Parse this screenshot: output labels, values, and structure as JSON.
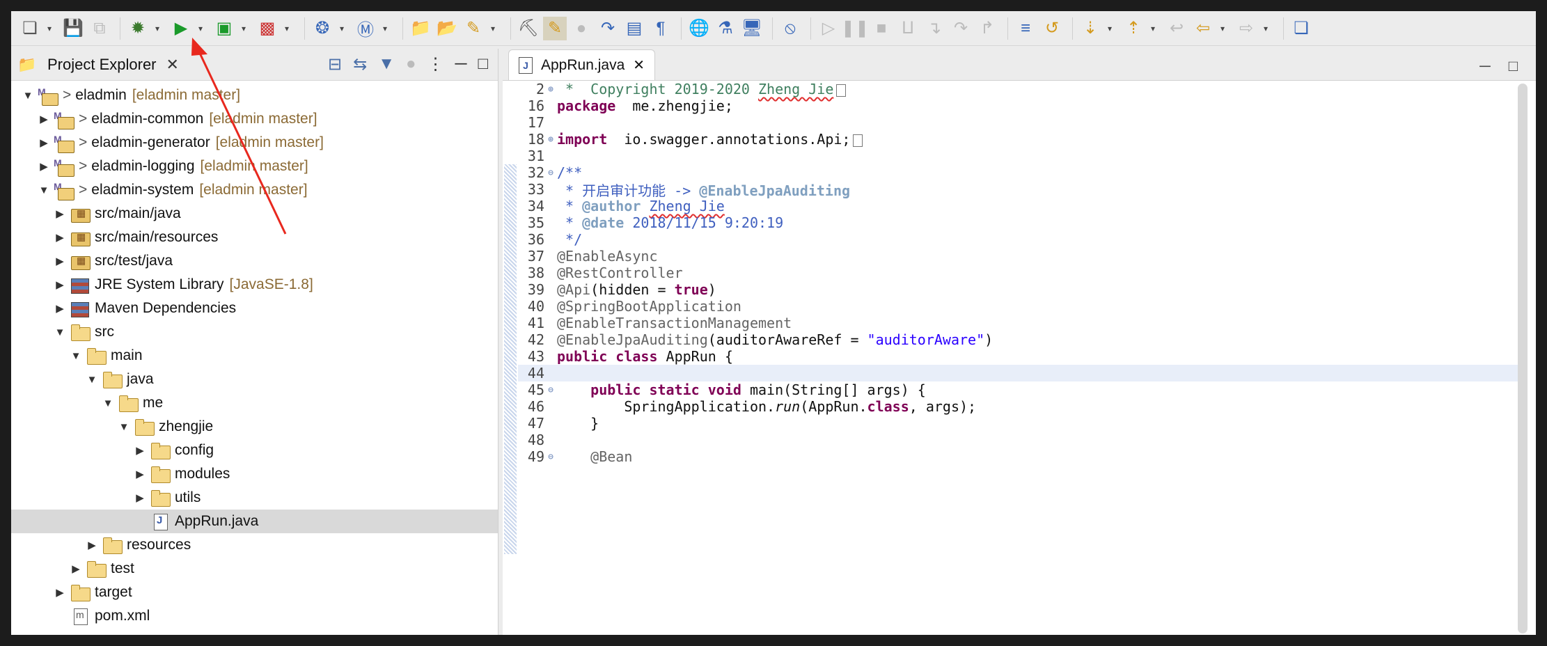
{
  "toolbar": {
    "icons": [
      "new-icon",
      "save-icon",
      "save-all-icon",
      "debug-icon",
      "run-icon",
      "coverage-icon",
      "run-last-icon",
      "external-tools-icon",
      "new-java-class-icon",
      "open-type-icon",
      "open-resource-icon",
      "search-icon",
      "toggle-mark-icon",
      "toggle-block-icon",
      "show-whitespace-icon",
      "globe-icon",
      "server-icon",
      "monitor-icon",
      "skip-breakpoints-icon",
      "resume-icon",
      "suspend-icon",
      "terminate-icon",
      "disconnect-icon",
      "step-into-icon",
      "step-over-icon",
      "step-return-icon",
      "next-annotation-icon",
      "prev-annotation-icon",
      "back-icon",
      "forward-icon",
      "open-perspective-icon"
    ]
  },
  "explorer": {
    "title": "Project Explorer",
    "tree": [
      {
        "label": "eladmin",
        "decoration": "[eladmin master]",
        "prefix": ">",
        "depth": 0,
        "expanded": "open",
        "icon": "proj"
      },
      {
        "label": "eladmin-common",
        "decoration": "[eladmin master]",
        "prefix": ">",
        "depth": 1,
        "expanded": "closed",
        "icon": "proj"
      },
      {
        "label": "eladmin-generator",
        "decoration": "[eladmin master]",
        "prefix": ">",
        "depth": 1,
        "expanded": "closed",
        "icon": "proj"
      },
      {
        "label": "eladmin-logging",
        "decoration": "[eladmin master]",
        "prefix": ">",
        "depth": 1,
        "expanded": "closed",
        "icon": "proj"
      },
      {
        "label": "eladmin-system",
        "decoration": "[eladmin master]",
        "prefix": ">",
        "depth": 1,
        "expanded": "open",
        "icon": "proj"
      },
      {
        "label": "src/main/java",
        "decoration": "",
        "prefix": "",
        "depth": 2,
        "expanded": "closed",
        "icon": "pkg"
      },
      {
        "label": "src/main/resources",
        "decoration": "",
        "prefix": "",
        "depth": 2,
        "expanded": "closed",
        "icon": "pkg"
      },
      {
        "label": "src/test/java",
        "decoration": "",
        "prefix": "",
        "depth": 2,
        "expanded": "closed",
        "icon": "pkg"
      },
      {
        "label": "JRE System Library",
        "decoration": "[JavaSE-1.8]",
        "prefix": "",
        "depth": 2,
        "expanded": "closed",
        "icon": "lib"
      },
      {
        "label": "Maven Dependencies",
        "decoration": "",
        "prefix": "",
        "depth": 2,
        "expanded": "closed",
        "icon": "lib"
      },
      {
        "label": "src",
        "decoration": "",
        "prefix": "",
        "depth": 2,
        "expanded": "open",
        "icon": "folder"
      },
      {
        "label": "main",
        "decoration": "",
        "prefix": "",
        "depth": 3,
        "expanded": "open",
        "icon": "folder"
      },
      {
        "label": "java",
        "decoration": "",
        "prefix": "",
        "depth": 4,
        "expanded": "open",
        "icon": "folder"
      },
      {
        "label": "me",
        "decoration": "",
        "prefix": "",
        "depth": 5,
        "expanded": "open",
        "icon": "folder"
      },
      {
        "label": "zhengjie",
        "decoration": "",
        "prefix": "",
        "depth": 6,
        "expanded": "open",
        "icon": "folder"
      },
      {
        "label": "config",
        "decoration": "",
        "prefix": "",
        "depth": 7,
        "expanded": "closed",
        "icon": "folder"
      },
      {
        "label": "modules",
        "decoration": "",
        "prefix": "",
        "depth": 7,
        "expanded": "closed",
        "icon": "folder"
      },
      {
        "label": "utils",
        "decoration": "",
        "prefix": "",
        "depth": 7,
        "expanded": "closed",
        "icon": "folder"
      },
      {
        "label": "AppRun.java",
        "decoration": "",
        "prefix": "",
        "depth": 7,
        "expanded": "none",
        "icon": "file",
        "selected": true
      },
      {
        "label": "resources",
        "decoration": "",
        "prefix": "",
        "depth": 4,
        "expanded": "closed",
        "icon": "folder"
      },
      {
        "label": "test",
        "decoration": "",
        "prefix": "",
        "depth": 3,
        "expanded": "closed",
        "icon": "folder"
      },
      {
        "label": "target",
        "decoration": "",
        "prefix": "",
        "depth": 2,
        "expanded": "closed",
        "icon": "folder"
      },
      {
        "label": "pom.xml",
        "decoration": "",
        "prefix": "",
        "depth": 2,
        "expanded": "none",
        "icon": "xml"
      }
    ]
  },
  "editor": {
    "tab_label": "AppRun.java",
    "lines": [
      {
        "num": "2",
        "fold": "plus",
        "segs": [
          [
            "cm",
            " *  Copyright 2019-2020 "
          ],
          [
            "cm sq",
            "Zheng Jie"
          ]
        ],
        "elide": true
      },
      {
        "num": "16",
        "segs": [
          [
            "kw",
            "package"
          ],
          [
            "",
            "  me.zhengjie;"
          ]
        ]
      },
      {
        "num": "17",
        "segs": []
      },
      {
        "num": "18",
        "fold": "plus",
        "segs": [
          [
            "kw",
            "import"
          ],
          [
            "",
            "  io.swagger.annotations.Api;"
          ]
        ],
        "elide": true
      },
      {
        "num": "31",
        "segs": []
      },
      {
        "num": "32",
        "fold": "minus",
        "segs": [
          [
            "jd",
            "/**"
          ]
        ]
      },
      {
        "num": "33",
        "segs": [
          [
            "jd",
            " * 开启审计功能 -> "
          ],
          [
            "tag",
            "@EnableJpaAuditing"
          ]
        ]
      },
      {
        "num": "34",
        "segs": [
          [
            "jd",
            " * "
          ],
          [
            "tag",
            "@author"
          ],
          [
            "jd",
            " "
          ],
          [
            "jd sq",
            "Zheng Jie"
          ]
        ]
      },
      {
        "num": "35",
        "segs": [
          [
            "jd",
            " * "
          ],
          [
            "tag",
            "@date"
          ],
          [
            "jd",
            " 2018/11/15 9:20:19"
          ]
        ]
      },
      {
        "num": "36",
        "segs": [
          [
            "jd",
            " */"
          ]
        ]
      },
      {
        "num": "37",
        "segs": [
          [
            "ann",
            "@EnableAsync"
          ]
        ]
      },
      {
        "num": "38",
        "segs": [
          [
            "ann",
            "@RestController"
          ]
        ]
      },
      {
        "num": "39",
        "segs": [
          [
            "ann",
            "@Api"
          ],
          [
            "",
            "(hidden = "
          ],
          [
            "kw",
            "true"
          ],
          [
            "",
            ")"
          ]
        ]
      },
      {
        "num": "40",
        "segs": [
          [
            "ann",
            "@SpringBootApplication"
          ]
        ]
      },
      {
        "num": "41",
        "segs": [
          [
            "ann",
            "@EnableTransactionManagement"
          ]
        ]
      },
      {
        "num": "42",
        "segs": [
          [
            "ann",
            "@EnableJpaAuditing"
          ],
          [
            "",
            "(auditorAwareRef = "
          ],
          [
            "str",
            "\"auditorAware\""
          ],
          [
            "",
            ")"
          ]
        ]
      },
      {
        "num": "43",
        "segs": [
          [
            "kw",
            "public"
          ],
          [
            "",
            " "
          ],
          [
            "kw",
            "class"
          ],
          [
            "",
            " AppRun {"
          ]
        ]
      },
      {
        "num": "44",
        "segs": [],
        "hl": true
      },
      {
        "num": "45",
        "fold": "minus",
        "segs": [
          [
            "",
            "    "
          ],
          [
            "kw",
            "public"
          ],
          [
            "",
            " "
          ],
          [
            "kw",
            "static"
          ],
          [
            "",
            " "
          ],
          [
            "kw",
            "void"
          ],
          [
            "",
            " main(String[] args) {"
          ]
        ]
      },
      {
        "num": "46",
        "segs": [
          [
            "",
            "        SpringApplication."
          ],
          [
            "ita",
            "run"
          ],
          [
            "",
            "(AppRun."
          ],
          [
            "kw",
            "class"
          ],
          [
            "",
            ", args);"
          ]
        ]
      },
      {
        "num": "47",
        "segs": [
          [
            "",
            "    }"
          ]
        ]
      },
      {
        "num": "48",
        "segs": []
      },
      {
        "num": "49",
        "fold": "minus",
        "segs": [
          [
            "",
            "    "
          ],
          [
            "ann",
            "@Bean"
          ]
        ]
      }
    ]
  },
  "colors": {
    "selection": "#d9d9d9",
    "current_line": "#e8eef9",
    "annotation_arrow": "#e8281e"
  }
}
